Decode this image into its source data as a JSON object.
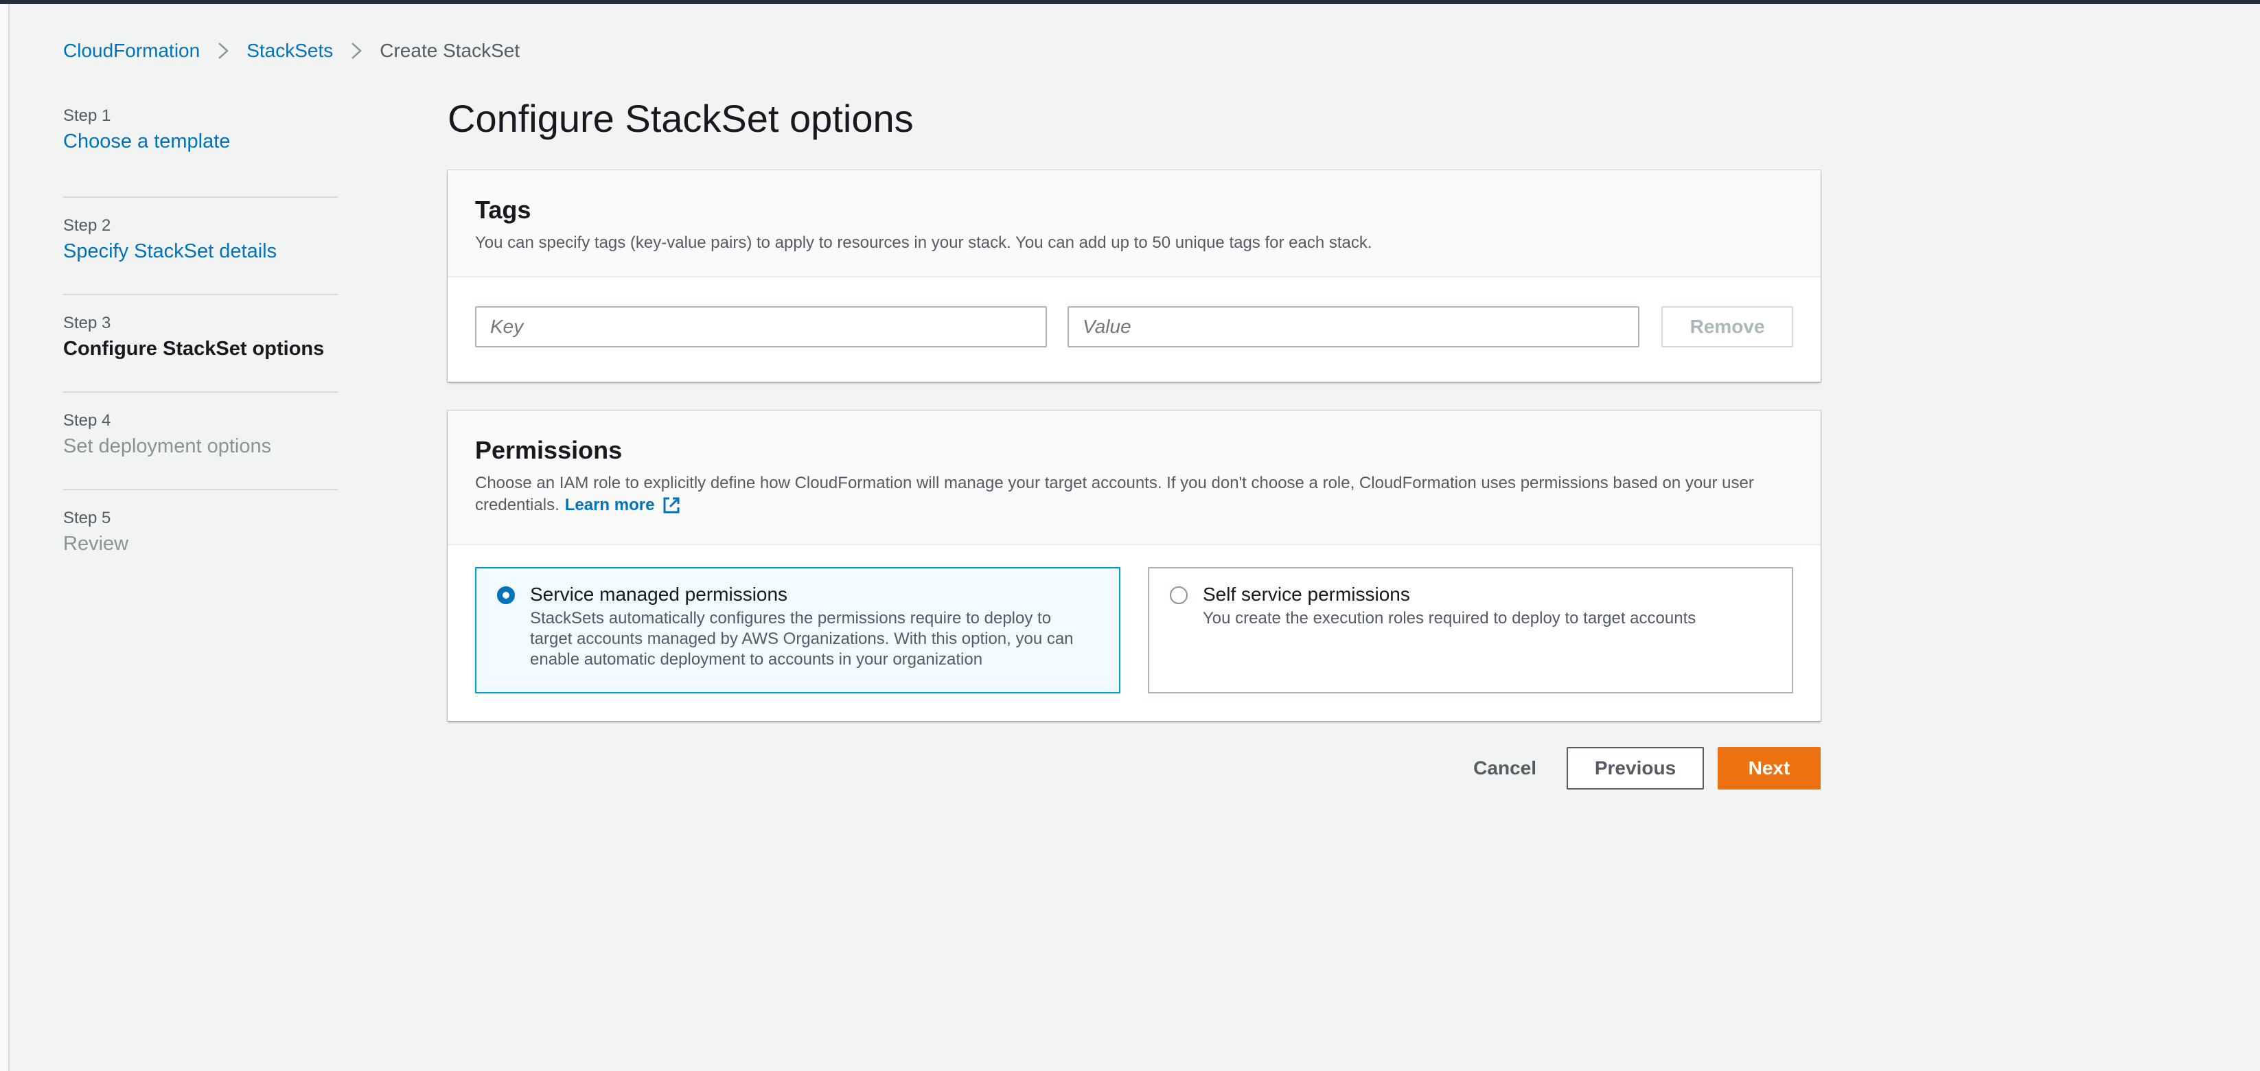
{
  "breadcrumb": {
    "items": [
      "CloudFormation",
      "StackSets",
      "Create StackSet"
    ]
  },
  "steps": [
    {
      "num": "Step 1",
      "title": "Choose a template",
      "state": "link"
    },
    {
      "num": "Step 2",
      "title": "Specify StackSet details",
      "state": "link"
    },
    {
      "num": "Step 3",
      "title": "Configure StackSet options",
      "state": "active"
    },
    {
      "num": "Step 4",
      "title": "Set deployment options",
      "state": "disabled"
    },
    {
      "num": "Step 5",
      "title": "Review",
      "state": "disabled"
    }
  ],
  "page": {
    "title": "Configure StackSet options"
  },
  "tags": {
    "title": "Tags",
    "description": "You can specify tags (key-value pairs) to apply to resources in your stack. You can add up to 50 unique tags for each stack.",
    "key_placeholder": "Key",
    "value_placeholder": "Value",
    "key_value": "",
    "value_value": "",
    "remove_label": "Remove"
  },
  "permissions": {
    "title": "Permissions",
    "description": "Choose an IAM role to explicitly define how CloudFormation will manage your target accounts. If you don't choose a role, CloudFormation uses permissions based on your user credentials.",
    "learn_more": "Learn more",
    "options": [
      {
        "title": "Service managed permissions",
        "description": "StackSets automatically configures the permissions require to deploy to target accounts managed by AWS Organizations. With this option, you can enable automatic deployment to accounts in your organization",
        "selected": true
      },
      {
        "title": "Self service permissions",
        "description": "You create the execution roles required to deploy to target accounts",
        "selected": false
      }
    ]
  },
  "actions": {
    "cancel": "Cancel",
    "previous": "Previous",
    "next": "Next"
  },
  "colors": {
    "accent": "#0073bb",
    "primary_button": "#ec7211",
    "selected_tile_border": "#00a1c9"
  },
  "icons": {
    "breadcrumb_separator": "chevron-right-icon",
    "learn_more": "external-link-icon"
  }
}
